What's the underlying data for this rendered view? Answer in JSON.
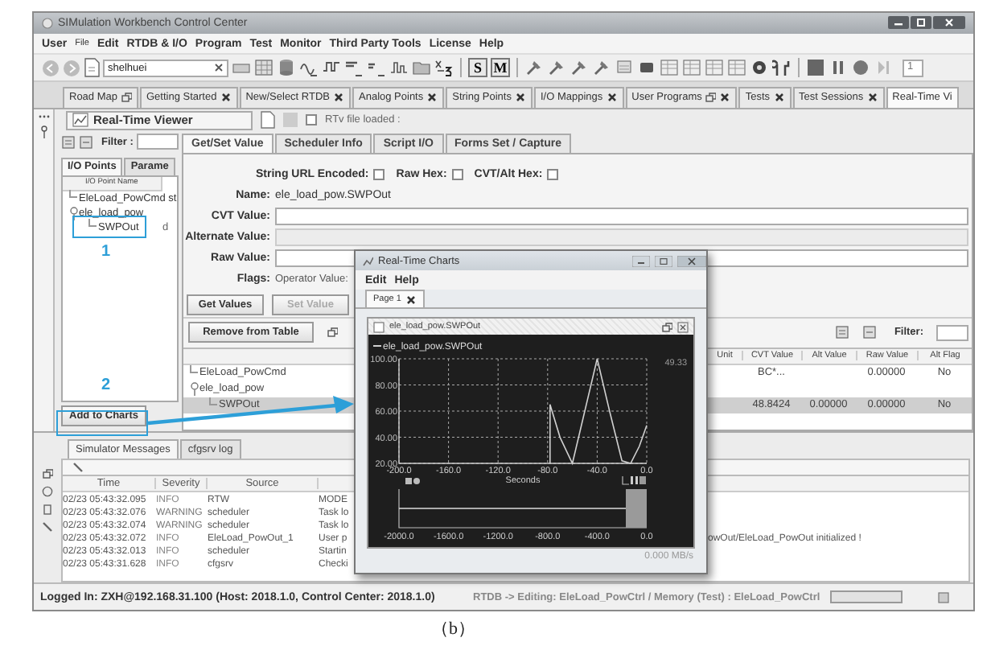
{
  "window": {
    "title": "SIMulation Workbench Control Center"
  },
  "menu": [
    {
      "label": "User",
      "small": false
    },
    {
      "label": "File",
      "small": true
    },
    {
      "label": "Edit",
      "small": false
    },
    {
      "label": "RTDB & I/O",
      "small": false
    },
    {
      "label": "Program",
      "small": false
    },
    {
      "label": "Test",
      "small": false
    },
    {
      "label": "Monitor",
      "small": false
    },
    {
      "label": "Third Party Tools",
      "small": false
    },
    {
      "label": "License",
      "small": false
    },
    {
      "label": "Help",
      "small": false
    }
  ],
  "toolbar": {
    "user_field": "shelhuei",
    "letter_buttons": [
      "S",
      "M"
    ],
    "page_field": "1"
  },
  "doc_tabs": [
    {
      "label": "Road Map",
      "kind": "detachable",
      "selected": false
    },
    {
      "label": "Getting Started",
      "kind": "closable",
      "selected": false
    },
    {
      "label": "New/Select RTDB",
      "kind": "closable",
      "selected": false
    },
    {
      "label": "Analog Points",
      "kind": "closable",
      "selected": false
    },
    {
      "label": "String Points",
      "kind": "closable",
      "selected": false
    },
    {
      "label": "I/O Mappings",
      "kind": "closable",
      "selected": false
    },
    {
      "label": "User Programs",
      "kind": "both",
      "selected": false
    },
    {
      "label": "Tests",
      "kind": "closable",
      "selected": false
    },
    {
      "label": "Test Sessions",
      "kind": "closable",
      "selected": false
    },
    {
      "label": "Real-Time Vi",
      "kind": "plain",
      "selected": true
    }
  ],
  "viewer": {
    "title": "Real-Time Viewer",
    "file_status": "RTv file loaded :",
    "file_loaded": false,
    "filter_label": "Filter :",
    "side_tabs": [
      {
        "label": "I/O Points",
        "selected": true
      },
      {
        "label": "Parame",
        "selected": false
      }
    ],
    "tree_header": "I/O Point Name",
    "tree": [
      {
        "label": "EleLoad_PowCmd st"
      },
      {
        "label": "ele_load_pow",
        "expanded": true,
        "children": [
          {
            "label": "SWPOut",
            "column_2": "d"
          }
        ]
      }
    ],
    "add_button": "Add to Charts",
    "tabs": [
      {
        "label": "Get/Set Value",
        "selected": true
      },
      {
        "label": "Scheduler Info",
        "selected": false
      },
      {
        "label": "Script I/O",
        "selected": false
      },
      {
        "label": "Forms Set / Capture",
        "selected": false
      }
    ],
    "options": [
      {
        "label": "String URL Encoded:",
        "checked": false
      },
      {
        "label": "Raw Hex:",
        "checked": false
      },
      {
        "label": "CVT/Alt Hex:",
        "checked": false
      }
    ],
    "name_label": "Name:",
    "name_value": "ele_load_pow.SWPOut",
    "fields": [
      {
        "label": "CVT Value:",
        "disabled": false
      },
      {
        "label": "Alternate Value:",
        "disabled": true
      },
      {
        "label": "Raw Value:",
        "disabled": false
      }
    ],
    "flags_label": "Flags:",
    "flags_value": "Operator Value:",
    "buttons": [
      {
        "label": "Get Values",
        "disabled": false
      },
      {
        "label": "Set Value",
        "disabled": true
      }
    ],
    "remove_button": "Remove from Table",
    "table_filter": "Filter:",
    "table": {
      "columns": [
        "Unit",
        "CVT Value",
        "Alt Value",
        "Raw Value",
        "Alt Flag"
      ],
      "rows": [
        {
          "name": "EleLoad_PowCmd",
          "selected": false,
          "cvt": "BC*...",
          "raw": "0.00000",
          "alt_flag": "No"
        },
        {
          "name": "ele_load_pow",
          "selected": false,
          "expanded": true,
          "children": [
            {
              "name": "SWPOut",
              "selected": true,
              "cvt": "48.8424",
              "alt": "0.00000",
              "raw": "0.00000",
              "alt_flag": "No"
            }
          ]
        }
      ]
    }
  },
  "messages": {
    "tabs": [
      {
        "label": "Simulator Messages",
        "selected": true
      },
      {
        "label": "cfgsrv log",
        "selected": false
      }
    ],
    "columns": [
      "Time",
      "Severity",
      "Source"
    ],
    "rows": [
      {
        "time": "02/23 05:43:32.095",
        "severity": "INFO",
        "source": "RTW",
        "message": "MODE"
      },
      {
        "time": "02/23 05:43:32.076",
        "severity": "WARNING",
        "source": "scheduler",
        "message": "Task lo"
      },
      {
        "time": "02/23 05:43:32.074",
        "severity": "WARNING",
        "source": "scheduler",
        "message": "Task lo"
      },
      {
        "time": "02/23 05:43:32.072",
        "severity": "INFO",
        "source": "EleLoad_PowOut_1",
        "message": "User p",
        "message_tail": "owOut/EleLoad_PowOut initialized !"
      },
      {
        "time": "02/23 05:43:32.013",
        "severity": "INFO",
        "source": "scheduler",
        "message": "Startin"
      },
      {
        "time": "02/23 05:43:31.628",
        "severity": "INFO",
        "source": "cfgsrv",
        "message": "Checki"
      }
    ]
  },
  "status_bar": {
    "login": "Logged In: ZXH@192.168.31.100 (Host: 2018.1.0, Control Center: 2018.1.0)",
    "rtdb": "RTDB -> Editing: EleLoad_PowCtrl / Memory (Test) : EleLoad_PowCtrl",
    "progress": {
      "level": 0
    }
  },
  "chart_window": {
    "title": "Real-Time Charts",
    "menu": [
      "Edit",
      "Help"
    ],
    "tabs": [
      {
        "label": "Page 1",
        "selected": true
      }
    ],
    "frame_title": "ele_load_pow.SWPOut",
    "chart_data": {
      "type": "line",
      "xlabel": "Seconds",
      "x": [
        -78,
        -78,
        -70,
        -60,
        -50,
        -40,
        -30,
        -20,
        -13,
        -6,
        0
      ],
      "series": [
        {
          "name": "ele_load_pow.SWPOut",
          "color": "#d0d0d0",
          "values": [
            20,
            65,
            40,
            20,
            60,
            100,
            60,
            22,
            20,
            33,
            49
          ]
        }
      ],
      "xlim": [
        -200,
        0
      ],
      "ylim": [
        20,
        100
      ],
      "grid": true,
      "xticks": [
        {
          "value": -200,
          "label": "-200.0"
        },
        {
          "value": -160,
          "label": "-160.0"
        },
        {
          "value": -120,
          "label": "-120.0"
        },
        {
          "value": -80,
          "label": "-80.0"
        },
        {
          "value": -40,
          "label": "-40.0"
        },
        {
          "value": 0,
          "label": "0.0"
        }
      ],
      "yticks": [
        {
          "value": 100,
          "label": "100.00"
        },
        {
          "value": 80,
          "label": "80.00"
        },
        {
          "value": 60,
          "label": "60.00"
        },
        {
          "value": 40,
          "label": "40.00"
        },
        {
          "value": 20,
          "label": "20.00"
        }
      ],
      "annotations": [
        "49.33"
      ]
    },
    "overview_ticks": [
      "-2000.0",
      "-1600.0",
      "-1200.0",
      "-800.0",
      "-400.0",
      "0.0"
    ],
    "rate": "0.000 MB/s"
  },
  "annotations": {
    "markers": [
      "1",
      "2"
    ]
  },
  "caption": "（b）"
}
